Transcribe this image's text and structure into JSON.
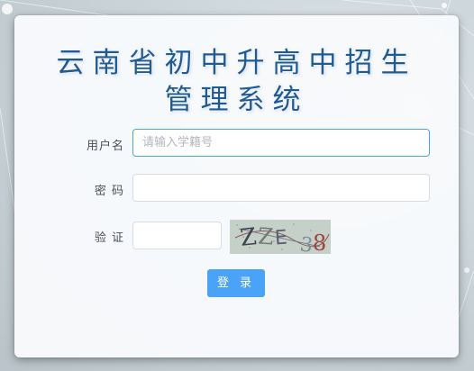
{
  "page": {
    "title_line1": "云南省初中升高中招生",
    "title_line2": "管理系统"
  },
  "login_form": {
    "username_label": "用户名",
    "username_placeholder": "请输入学籍号",
    "username_value": "",
    "password_label": "密 码",
    "password_value": "",
    "captcha_label": "验 证",
    "captcha_value": "",
    "captcha_image_text": "ZZE38",
    "login_button_label": "登 录"
  },
  "colors": {
    "title": "#1f5a93",
    "button": "#4aa3f6",
    "focus_border": "#4da1f0"
  }
}
